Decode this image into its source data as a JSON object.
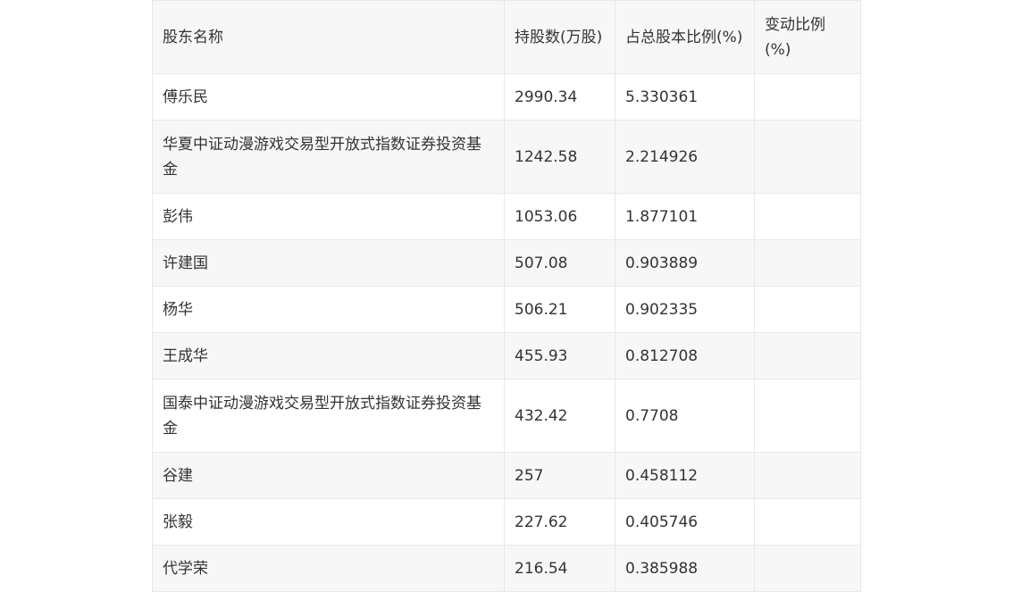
{
  "table": {
    "headers": {
      "name": "股东名称",
      "shares": "持股数(万股)",
      "ratio": "占总股本比例(%)",
      "change": "变动比例(%)"
    },
    "rows": [
      {
        "name": "傅乐民",
        "shares": "2990.34",
        "ratio": "5.330361",
        "change": ""
      },
      {
        "name": "华夏中证动漫游戏交易型开放式指数证券投资基金",
        "shares": "1242.58",
        "ratio": "2.214926",
        "change": ""
      },
      {
        "name": "彭伟",
        "shares": "1053.06",
        "ratio": "1.877101",
        "change": ""
      },
      {
        "name": "许建国",
        "shares": "507.08",
        "ratio": "0.903889",
        "change": ""
      },
      {
        "name": "杨华",
        "shares": "506.21",
        "ratio": "0.902335",
        "change": ""
      },
      {
        "name": "王成华",
        "shares": "455.93",
        "ratio": "0.812708",
        "change": ""
      },
      {
        "name": "国泰中证动漫游戏交易型开放式指数证券投资基金",
        "shares": "432.42",
        "ratio": "0.7708",
        "change": ""
      },
      {
        "name": "谷建",
        "shares": "257",
        "ratio": "0.458112",
        "change": ""
      },
      {
        "name": "张毅",
        "shares": "227.62",
        "ratio": "0.405746",
        "change": ""
      },
      {
        "name": "代学荣",
        "shares": "216.54",
        "ratio": "0.385988",
        "change": ""
      }
    ]
  }
}
